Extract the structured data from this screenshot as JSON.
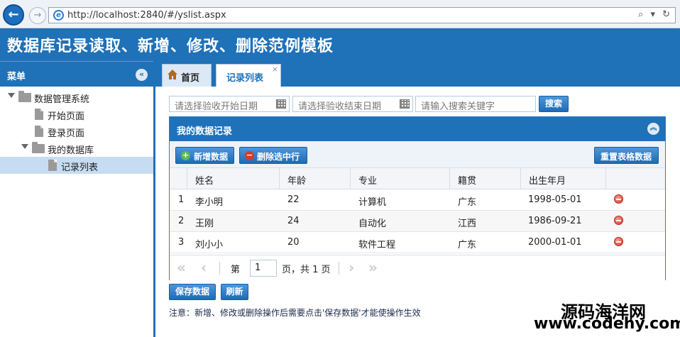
{
  "browser": {
    "url": "http://localhost:2840/#/yslist.aspx",
    "tools": "⌕ ▾ ↻"
  },
  "app": {
    "title": "数据库记录读取、新增、修改、删除范例模板"
  },
  "sidebar": {
    "title": "菜单",
    "tree": [
      {
        "label": "数据管理系统",
        "type": "folder"
      },
      {
        "label": "开始页面",
        "type": "file"
      },
      {
        "label": "登录页面",
        "type": "file"
      },
      {
        "label": "我的数据库",
        "type": "folder"
      },
      {
        "label": "记录列表",
        "type": "file",
        "selected": true
      }
    ]
  },
  "tabs": [
    {
      "label": "首页"
    },
    {
      "label": "记录列表",
      "close": "×"
    }
  ],
  "search": {
    "start_placeholder": "请选择验收开始日期",
    "end_placeholder": "请选择验收结束日期",
    "keyword_placeholder": "请输入搜索关键字",
    "button": "搜索"
  },
  "panel": {
    "title": "我的数据记录",
    "toolbar": {
      "add": "新增数据",
      "delete_selected": "删除选中行",
      "reset": "重置表格数据"
    },
    "columns": [
      "姓名",
      "年龄",
      "专业",
      "籍贯",
      "出生年月"
    ],
    "rows": [
      {
        "idx": "1",
        "name": "李小明",
        "age": "22",
        "major": "计算机",
        "origin": "广东",
        "birth": "1998-05-01"
      },
      {
        "idx": "2",
        "name": "王刚",
        "age": "24",
        "major": "自动化",
        "origin": "江西",
        "birth": "1986-09-21"
      },
      {
        "idx": "3",
        "name": "刘小小",
        "age": "20",
        "major": "软件工程",
        "origin": "广东",
        "birth": "2000-01-01"
      }
    ],
    "pager": {
      "before": "第",
      "page": "1",
      "after": "页，共 1 页"
    }
  },
  "actions": {
    "save": "保存数据",
    "refresh": "刷新"
  },
  "note": "注意：新增、修改或删除操作后需要点击'保存数据'才能使操作生效",
  "watermark": {
    "line1": "源码海洋网",
    "line2": "www.codehy.com"
  },
  "colors": {
    "primary": "#1f71b8",
    "danger": "#d63c2a"
  }
}
